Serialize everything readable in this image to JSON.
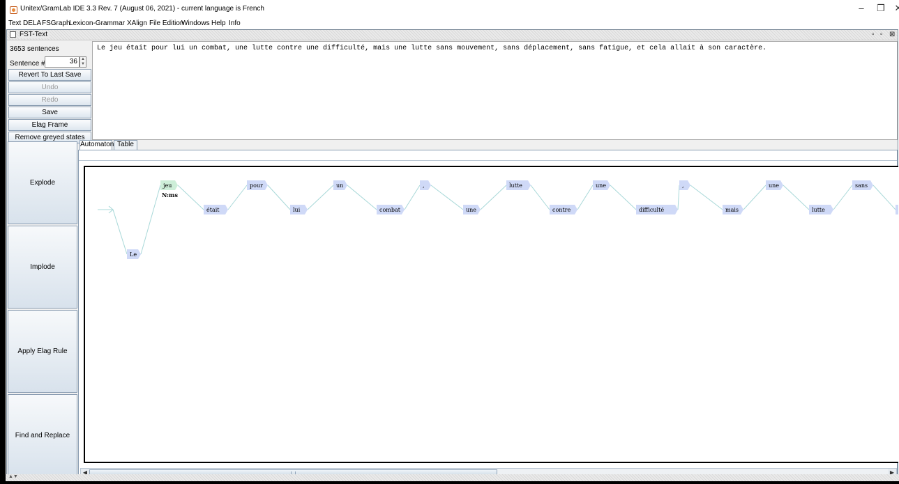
{
  "window": {
    "title": "Unitex/GramLab IDE 3.3  Rev. 7 (August 06, 2021) - current language is French",
    "controls": [
      "–",
      "❐",
      "✕"
    ]
  },
  "menu": [
    "Text",
    "DELA",
    "FSGraph",
    "Lexicon-Grammar",
    "XAlign",
    "File Edition",
    "Windows",
    "Help",
    "Info"
  ],
  "frame": {
    "title": "FST-Text",
    "controls": [
      "▫",
      "▫",
      "⊠"
    ]
  },
  "left_panel": {
    "sentence_count": "3653 sentences",
    "sentence_label": "Sentence #",
    "sentence_value": "36",
    "buttons": [
      {
        "label": "Revert To Last Save",
        "enabled": true
      },
      {
        "label": "Undo",
        "enabled": false
      },
      {
        "label": "Redo",
        "enabled": false
      },
      {
        "label": "Save",
        "enabled": true
      },
      {
        "label": "Elag Frame",
        "enabled": true
      },
      {
        "label": "Remove greyed states",
        "enabled": true
      }
    ]
  },
  "sentence_text": "Le jeu était pour lui un combat, une lutte contre une difficulté, mais une lutte sans mouvement, sans déplacement, sans fatigue, et cela allait à son caractère.",
  "big_buttons": [
    "Explode",
    "Implode",
    "Apply Elag Rule",
    "Find and Replace"
  ],
  "tabs": [
    {
      "label": "Automaton",
      "active": true
    },
    {
      "label": "Table",
      "active": false
    }
  ],
  "automaton": {
    "nodes": [
      "Le",
      "jeu",
      "était",
      "pour",
      "lui",
      "un",
      "combat",
      ",",
      "une",
      "lutte",
      "contre",
      "une",
      "difficulté",
      ",",
      "mais",
      "une",
      "lutte",
      "sans",
      "mouvemen"
    ],
    "highlighted_node_index": 1,
    "highlighted_node_annotation": "N:ms",
    "colors": {
      "box": "#cfd9f7",
      "highlight": "#cdeed8",
      "edge": "#a8d8d8"
    }
  }
}
